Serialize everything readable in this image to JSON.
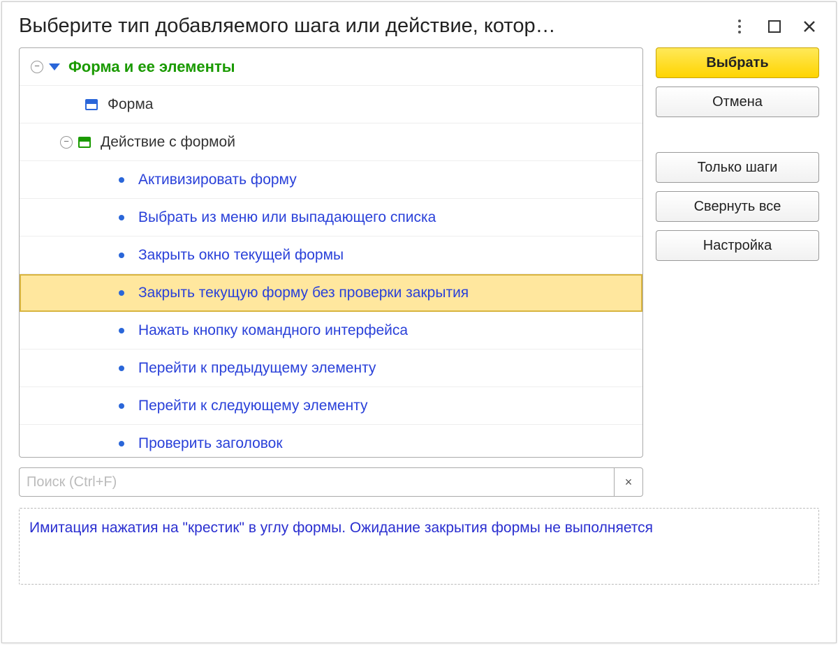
{
  "window": {
    "title": "Выберите тип добавляемого шага или действие, котор…"
  },
  "tree": {
    "header": "Форма и ее элементы",
    "form_label": "Форма",
    "group_label": "Действие с формой",
    "actions": [
      "Активизировать форму",
      "Выбрать из меню или выпадающего списка",
      "Закрыть окно текущей формы",
      "Закрыть текущую форму без проверки закрытия",
      "Нажать кнопку командного интерфейса",
      "Перейти к предыдущему элементу",
      "Перейти к следующему элементу",
      "Проверить заголовок"
    ],
    "selected_index": 3
  },
  "search": {
    "placeholder": "Поиск (Ctrl+F)",
    "value": ""
  },
  "description": "Имитация нажатия на \"крестик\" в углу формы. Ожидание закрытия формы не выполняется",
  "buttons": {
    "select": "Выбрать",
    "cancel": "Отмена",
    "only_steps": "Только шаги",
    "collapse_all": "Свернуть все",
    "settings": "Настройка"
  }
}
